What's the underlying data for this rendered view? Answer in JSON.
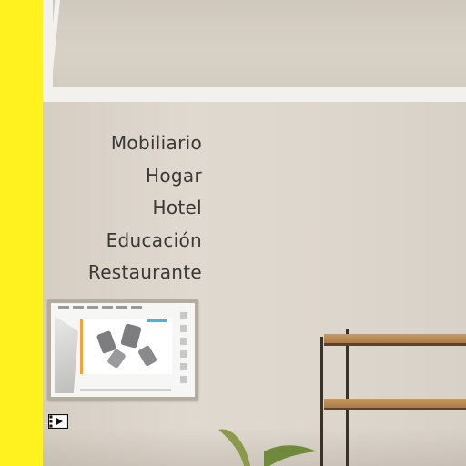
{
  "theme": {
    "accent_color": "#fff21f",
    "text_color": "#3a3837"
  },
  "menu": {
    "items": [
      {
        "label": "Mobiliario"
      },
      {
        "label": "Hogar"
      },
      {
        "label": "Hotel"
      },
      {
        "label": "Educación"
      },
      {
        "label": "Restaurante"
      }
    ]
  },
  "media": {
    "icon": "video-play-icon"
  }
}
